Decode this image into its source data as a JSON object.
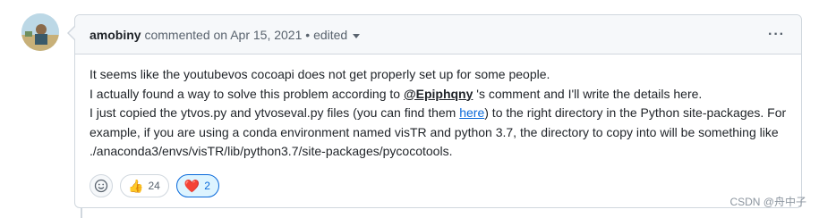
{
  "header": {
    "author": "amobiny",
    "action": "commented on",
    "date": "Apr 15, 2021",
    "separator": "•",
    "edited": "edited",
    "more": "···"
  },
  "body": {
    "line1": "It seems like the youtubevos cocoapi does not get properly set up for some people.",
    "line2_pre": "I actually found a way to solve this problem according to ",
    "line2_mention": "@Epiphqny",
    "line2_post": " 's comment and I'll write the details here.",
    "line3_pre": "I just copied the ytvos.py and ytvoseval.py files (you can find them ",
    "line3_link": "here",
    "line3_post": ") to the right directory in the Python site-packages. For example, if you are using a conda environment named visTR and python 3.7, the directory to copy into will be something like ./anaconda3/envs/visTR/lib/python3.7/site-packages/pycocotools."
  },
  "reactions": {
    "add_icon": "smiley-icon",
    "thumbs_up": {
      "emoji": "👍",
      "count": "24"
    },
    "heart": {
      "emoji": "❤️",
      "count": "2"
    }
  },
  "watermark": "CSDN @舟中子"
}
